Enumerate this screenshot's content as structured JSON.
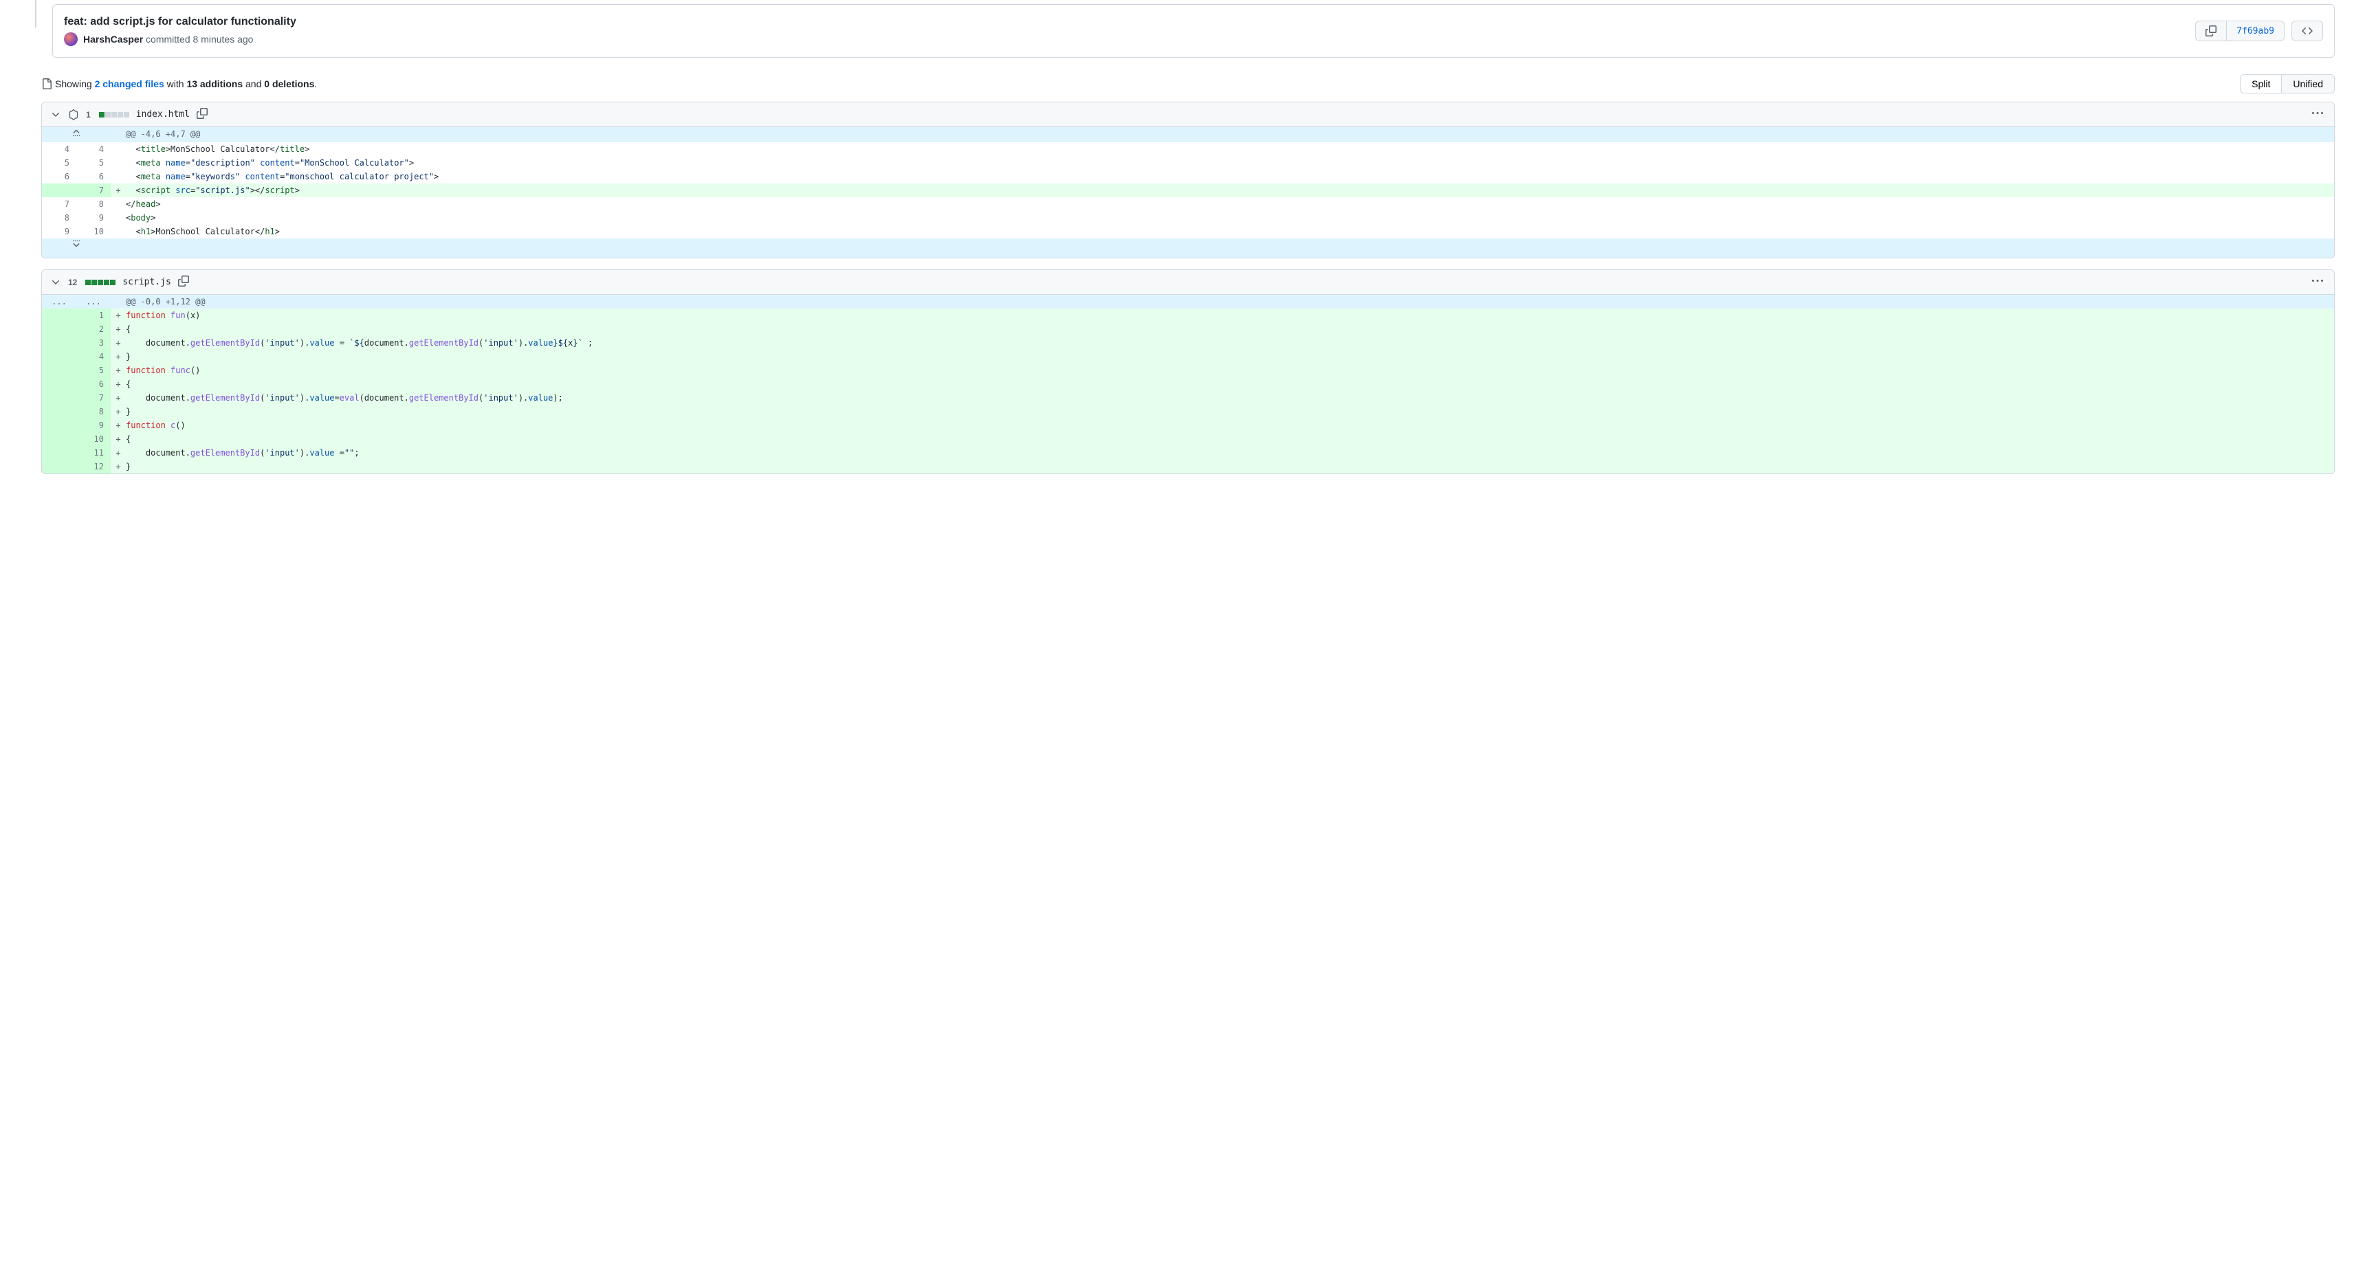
{
  "commit": {
    "title": "feat: add script.js for calculator functionality",
    "author": "HarshCasper",
    "action": "committed",
    "time": "8 minutes ago",
    "sha": "7f69ab9"
  },
  "summary": {
    "prefix": "Showing",
    "changed_files_link": "2 changed files",
    "with_text": "with",
    "additions": "13 additions",
    "and_text": "and",
    "deletions": "0 deletions",
    "suffix": "."
  },
  "view_toggle": {
    "split": "Split",
    "unified": "Unified"
  },
  "files": [
    {
      "name": "index.html",
      "changes": "1",
      "add_bars": 1,
      "total_bars": 5,
      "hunk_header": "@@ -4,6 +4,7 @@",
      "lines": [
        {
          "type": "ctx",
          "old": "4",
          "new": "4",
          "html": "  &lt;<span class=\"pl-ent\">title</span>&gt;MonSchool Calculator&lt;/<span class=\"pl-ent\">title</span>&gt;"
        },
        {
          "type": "ctx",
          "old": "5",
          "new": "5",
          "html": "  &lt;<span class=\"pl-ent\">meta</span> <span class=\"pl-e\">name</span>=<span class=\"pl-s\">\"description\"</span> <span class=\"pl-e\">content</span>=<span class=\"pl-s\">\"MonSchool Calculator\"</span>&gt;"
        },
        {
          "type": "ctx",
          "old": "6",
          "new": "6",
          "html": "  &lt;<span class=\"pl-ent\">meta</span> <span class=\"pl-e\">name</span>=<span class=\"pl-s\">\"keywords\"</span> <span class=\"pl-e\">content</span>=<span class=\"pl-s\">\"monschool calculator project\"</span>&gt;"
        },
        {
          "type": "add",
          "old": "",
          "new": "7",
          "html": "  &lt;<span class=\"pl-ent\">script</span> <span class=\"pl-e\">src</span>=<span class=\"pl-s\">\"script.js\"</span>&gt;&lt;/<span class=\"pl-ent\">script</span>&gt;"
        },
        {
          "type": "ctx",
          "old": "7",
          "new": "8",
          "html": "&lt;/<span class=\"pl-ent\">head</span>&gt;"
        },
        {
          "type": "ctx",
          "old": "8",
          "new": "9",
          "html": "&lt;<span class=\"pl-ent\">body</span>&gt;"
        },
        {
          "type": "ctx",
          "old": "9",
          "new": "10",
          "html": "  &lt;<span class=\"pl-ent\">h1</span>&gt;MonSchool Calculator&lt;/<span class=\"pl-ent\">h1</span>&gt;"
        }
      ]
    },
    {
      "name": "script.js",
      "changes": "12",
      "add_bars": 5,
      "total_bars": 5,
      "hunk_header": "@@ -0,0 +1,12 @@",
      "hunk_left": "...",
      "hunk_right": "...",
      "lines": [
        {
          "type": "add",
          "old": "",
          "new": "1",
          "html": "<span class=\"pl-k\">function</span> <span class=\"pl-en\">fun</span>(x)"
        },
        {
          "type": "add",
          "old": "",
          "new": "2",
          "html": "{"
        },
        {
          "type": "add",
          "old": "",
          "new": "3",
          "html": "    document.<span class=\"pl-en\">getElementById</span>(<span class=\"pl-s\">'input'</span>).<span class=\"pl-c1\">value</span> = <span class=\"pl-s\">`${</span>document.<span class=\"pl-en\">getElementById</span>(<span class=\"pl-s\">'input'</span>).<span class=\"pl-c1\">value</span><span class=\"pl-s\">}${</span>x<span class=\"pl-s\">}`</span> ;"
        },
        {
          "type": "add",
          "old": "",
          "new": "4",
          "html": "}"
        },
        {
          "type": "add",
          "old": "",
          "new": "5",
          "html": "<span class=\"pl-k\">function</span> <span class=\"pl-en\">func</span>()"
        },
        {
          "type": "add",
          "old": "",
          "new": "6",
          "html": "{"
        },
        {
          "type": "add",
          "old": "",
          "new": "7",
          "html": "    document.<span class=\"pl-en\">getElementById</span>(<span class=\"pl-s\">'input'</span>).<span class=\"pl-c1\">value</span>=<span class=\"pl-en\">eval</span>(document.<span class=\"pl-en\">getElementById</span>(<span class=\"pl-s\">'input'</span>).<span class=\"pl-c1\">value</span>);"
        },
        {
          "type": "add",
          "old": "",
          "new": "8",
          "html": "}"
        },
        {
          "type": "add",
          "old": "",
          "new": "9",
          "html": "<span class=\"pl-k\">function</span> <span class=\"pl-en\">c</span>()"
        },
        {
          "type": "add",
          "old": "",
          "new": "10",
          "html": "{"
        },
        {
          "type": "add",
          "old": "",
          "new": "11",
          "html": "    document.<span class=\"pl-en\">getElementById</span>(<span class=\"pl-s\">'input'</span>).<span class=\"pl-c1\">value</span> =<span class=\"pl-s\">\"\"</span>;"
        },
        {
          "type": "add",
          "old": "",
          "new": "12",
          "html": "}"
        }
      ]
    }
  ]
}
